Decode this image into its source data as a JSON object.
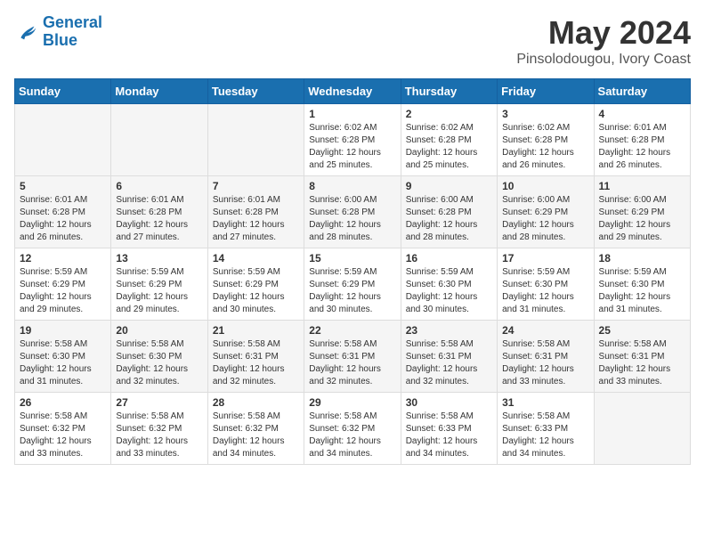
{
  "header": {
    "logo_line1": "General",
    "logo_line2": "Blue",
    "title": "May 2024",
    "location": "Pinsolodougou, Ivory Coast"
  },
  "days_of_week": [
    "Sunday",
    "Monday",
    "Tuesday",
    "Wednesday",
    "Thursday",
    "Friday",
    "Saturday"
  ],
  "weeks": [
    [
      {
        "day": "",
        "info": ""
      },
      {
        "day": "",
        "info": ""
      },
      {
        "day": "",
        "info": ""
      },
      {
        "day": "1",
        "info": "Sunrise: 6:02 AM\nSunset: 6:28 PM\nDaylight: 12 hours\nand 25 minutes."
      },
      {
        "day": "2",
        "info": "Sunrise: 6:02 AM\nSunset: 6:28 PM\nDaylight: 12 hours\nand 25 minutes."
      },
      {
        "day": "3",
        "info": "Sunrise: 6:02 AM\nSunset: 6:28 PM\nDaylight: 12 hours\nand 26 minutes."
      },
      {
        "day": "4",
        "info": "Sunrise: 6:01 AM\nSunset: 6:28 PM\nDaylight: 12 hours\nand 26 minutes."
      }
    ],
    [
      {
        "day": "5",
        "info": "Sunrise: 6:01 AM\nSunset: 6:28 PM\nDaylight: 12 hours\nand 26 minutes."
      },
      {
        "day": "6",
        "info": "Sunrise: 6:01 AM\nSunset: 6:28 PM\nDaylight: 12 hours\nand 27 minutes."
      },
      {
        "day": "7",
        "info": "Sunrise: 6:01 AM\nSunset: 6:28 PM\nDaylight: 12 hours\nand 27 minutes."
      },
      {
        "day": "8",
        "info": "Sunrise: 6:00 AM\nSunset: 6:28 PM\nDaylight: 12 hours\nand 28 minutes."
      },
      {
        "day": "9",
        "info": "Sunrise: 6:00 AM\nSunset: 6:28 PM\nDaylight: 12 hours\nand 28 minutes."
      },
      {
        "day": "10",
        "info": "Sunrise: 6:00 AM\nSunset: 6:29 PM\nDaylight: 12 hours\nand 28 minutes."
      },
      {
        "day": "11",
        "info": "Sunrise: 6:00 AM\nSunset: 6:29 PM\nDaylight: 12 hours\nand 29 minutes."
      }
    ],
    [
      {
        "day": "12",
        "info": "Sunrise: 5:59 AM\nSunset: 6:29 PM\nDaylight: 12 hours\nand 29 minutes."
      },
      {
        "day": "13",
        "info": "Sunrise: 5:59 AM\nSunset: 6:29 PM\nDaylight: 12 hours\nand 29 minutes."
      },
      {
        "day": "14",
        "info": "Sunrise: 5:59 AM\nSunset: 6:29 PM\nDaylight: 12 hours\nand 30 minutes."
      },
      {
        "day": "15",
        "info": "Sunrise: 5:59 AM\nSunset: 6:29 PM\nDaylight: 12 hours\nand 30 minutes."
      },
      {
        "day": "16",
        "info": "Sunrise: 5:59 AM\nSunset: 6:30 PM\nDaylight: 12 hours\nand 30 minutes."
      },
      {
        "day": "17",
        "info": "Sunrise: 5:59 AM\nSunset: 6:30 PM\nDaylight: 12 hours\nand 31 minutes."
      },
      {
        "day": "18",
        "info": "Sunrise: 5:59 AM\nSunset: 6:30 PM\nDaylight: 12 hours\nand 31 minutes."
      }
    ],
    [
      {
        "day": "19",
        "info": "Sunrise: 5:58 AM\nSunset: 6:30 PM\nDaylight: 12 hours\nand 31 minutes."
      },
      {
        "day": "20",
        "info": "Sunrise: 5:58 AM\nSunset: 6:30 PM\nDaylight: 12 hours\nand 32 minutes."
      },
      {
        "day": "21",
        "info": "Sunrise: 5:58 AM\nSunset: 6:31 PM\nDaylight: 12 hours\nand 32 minutes."
      },
      {
        "day": "22",
        "info": "Sunrise: 5:58 AM\nSunset: 6:31 PM\nDaylight: 12 hours\nand 32 minutes."
      },
      {
        "day": "23",
        "info": "Sunrise: 5:58 AM\nSunset: 6:31 PM\nDaylight: 12 hours\nand 32 minutes."
      },
      {
        "day": "24",
        "info": "Sunrise: 5:58 AM\nSunset: 6:31 PM\nDaylight: 12 hours\nand 33 minutes."
      },
      {
        "day": "25",
        "info": "Sunrise: 5:58 AM\nSunset: 6:31 PM\nDaylight: 12 hours\nand 33 minutes."
      }
    ],
    [
      {
        "day": "26",
        "info": "Sunrise: 5:58 AM\nSunset: 6:32 PM\nDaylight: 12 hours\nand 33 minutes."
      },
      {
        "day": "27",
        "info": "Sunrise: 5:58 AM\nSunset: 6:32 PM\nDaylight: 12 hours\nand 33 minutes."
      },
      {
        "day": "28",
        "info": "Sunrise: 5:58 AM\nSunset: 6:32 PM\nDaylight: 12 hours\nand 34 minutes."
      },
      {
        "day": "29",
        "info": "Sunrise: 5:58 AM\nSunset: 6:32 PM\nDaylight: 12 hours\nand 34 minutes."
      },
      {
        "day": "30",
        "info": "Sunrise: 5:58 AM\nSunset: 6:33 PM\nDaylight: 12 hours\nand 34 minutes."
      },
      {
        "day": "31",
        "info": "Sunrise: 5:58 AM\nSunset: 6:33 PM\nDaylight: 12 hours\nand 34 minutes."
      },
      {
        "day": "",
        "info": ""
      }
    ]
  ]
}
